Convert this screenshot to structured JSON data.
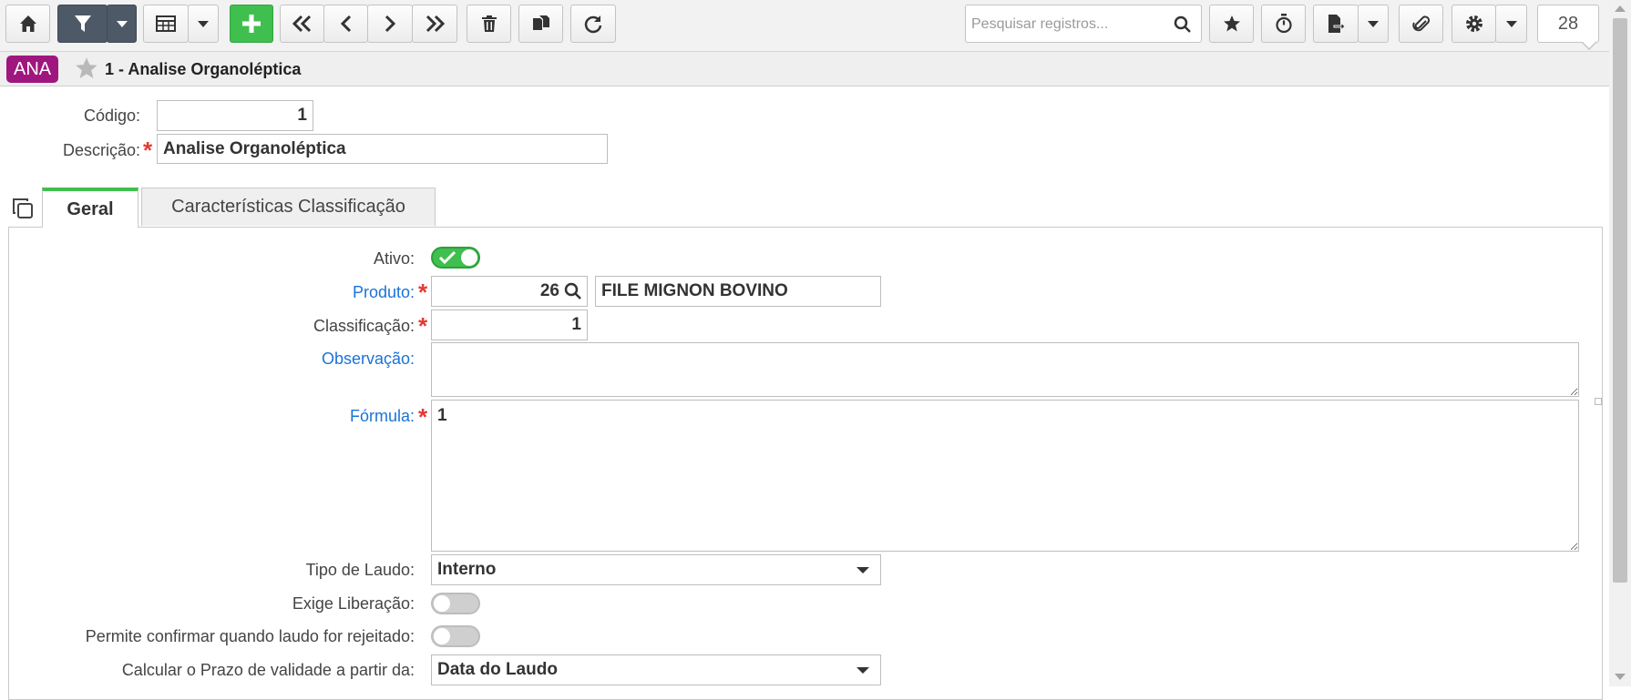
{
  "toolbar": {
    "search_placeholder": "Pesquisar registros...",
    "record_count": "28",
    "buttons": [
      "home-icon",
      "filter-icon",
      "grid-icon",
      "add-icon",
      "first-icon",
      "previous-icon",
      "next-icon",
      "last-icon",
      "delete-icon",
      "copy-icon",
      "refresh-icon",
      "favorites-icon",
      "timer-icon",
      "export-icon",
      "attachment-icon",
      "settings-icon"
    ]
  },
  "header": {
    "module_badge": "ANA",
    "record_title": "1 - Analise Organoléptica"
  },
  "form": {
    "codigo_label": "Código:",
    "codigo_value": "1",
    "descricao_label": "Descrição:",
    "descricao_value": "Analise Organoléptica"
  },
  "tabs": [
    {
      "label": "Geral",
      "active": true
    },
    {
      "label": "Características Classificação",
      "active": false
    }
  ],
  "geral": {
    "ativo_label": "Ativo:",
    "ativo_value": true,
    "produto_label": "Produto:",
    "produto_code": "26",
    "produto_name": "FILE MIGNON BOVINO",
    "classificacao_label": "Classificação:",
    "classificacao_value": "1",
    "observacao_label": "Observação:",
    "observacao_value": "",
    "formula_label": "Fórmula:",
    "formula_value": "1",
    "tipo_laudo_label": "Tipo de Laudo:",
    "tipo_laudo_value": "Interno",
    "exige_liberacao_label": "Exige Liberação:",
    "exige_liberacao_value": false,
    "permite_confirmar_label": "Permite confirmar quando laudo for rejeitado:",
    "permite_confirmar_value": false,
    "calcular_prazo_label": "Calcular o Prazo de validade a partir da:",
    "calcular_prazo_value": "Data do Laudo"
  },
  "colors": {
    "accent_green": "#3fbf4e",
    "badge_purple": "#a0167f",
    "link_blue": "#1a73d9",
    "required_red": "#e53935",
    "filter_dark": "#4d5966"
  }
}
